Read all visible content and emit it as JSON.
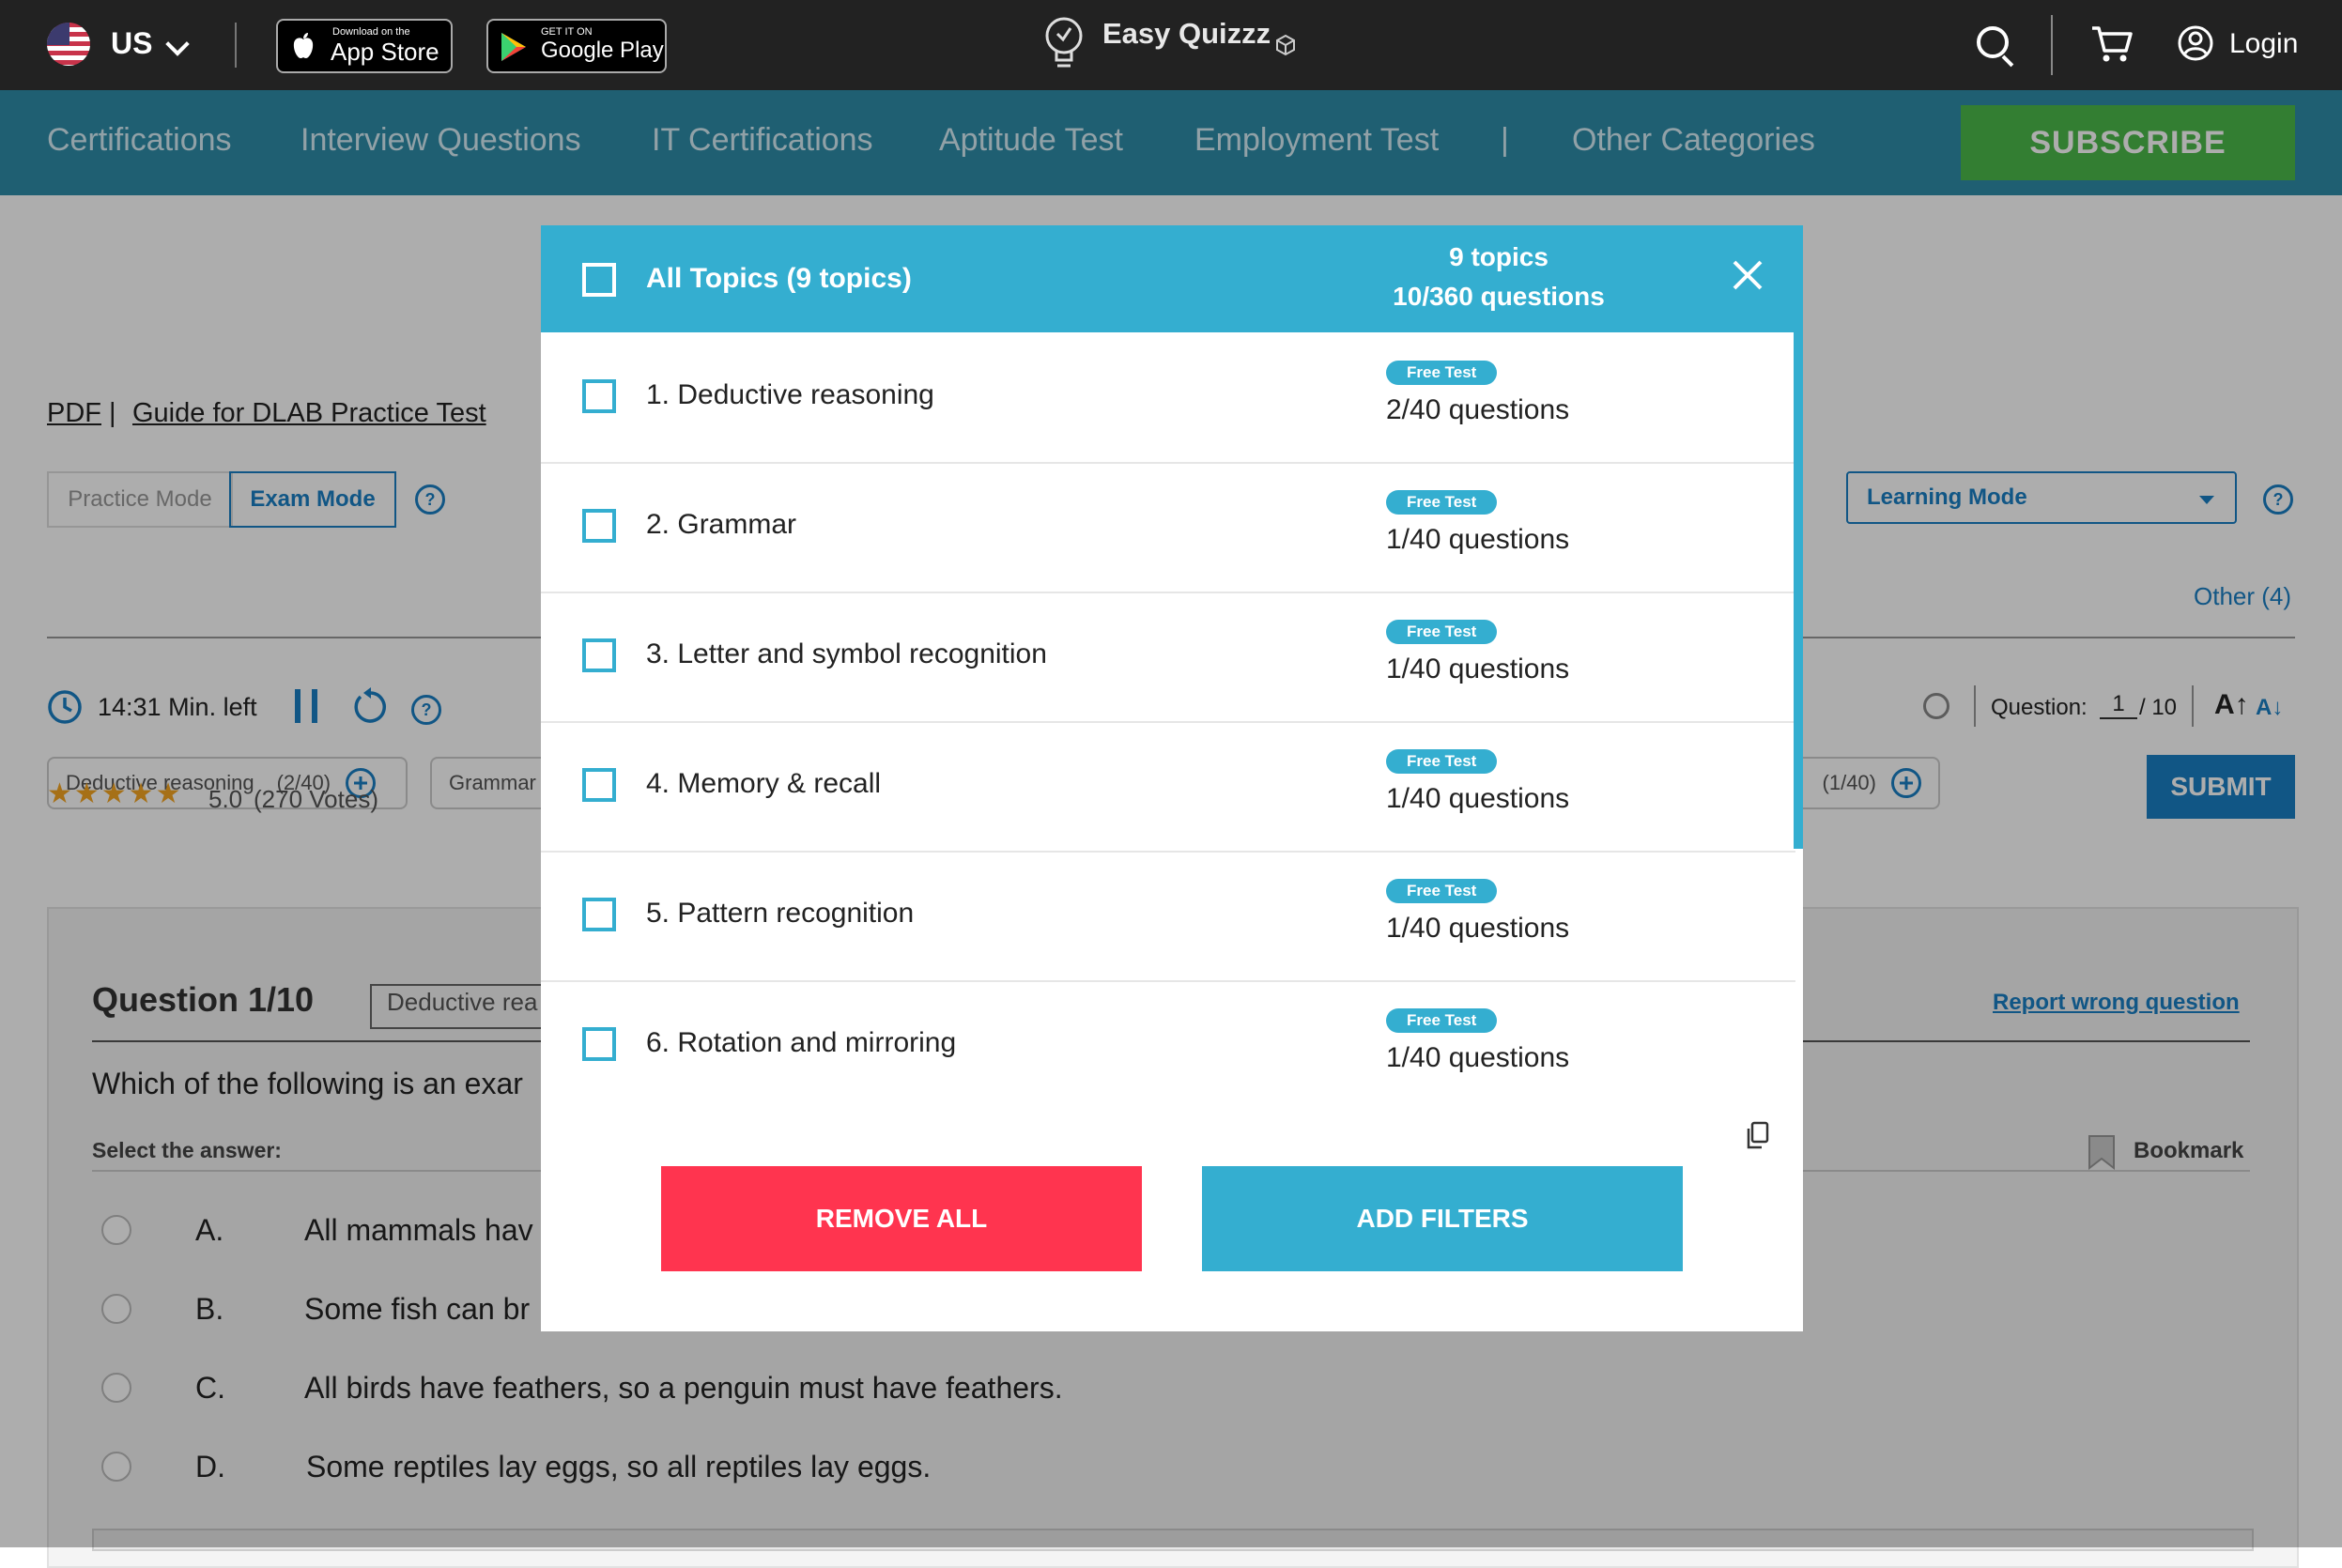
{
  "topbar": {
    "country": "US",
    "appstore_small": "Download on the",
    "appstore_big": "App Store",
    "googleplay_small": "GET IT ON",
    "googleplay_big": "Google Play",
    "brand": "Easy Quizzz",
    "login": "Login"
  },
  "nav": {
    "items": [
      "Certifications",
      "Interview Questions",
      "IT Certifications",
      "Aptitude Test",
      "Employment Test",
      "|",
      "Other Categories"
    ],
    "subscribe": "SUBSCRIBE"
  },
  "page": {
    "breadcrumb_pdf": "PDF",
    "breadcrumb_sep": "|",
    "breadcrumb_title": "Guide for DLAB Practice Test",
    "practice_mode": "Practice Mode",
    "exam_mode": "Exam Mode",
    "learning_mode": "Learning Mode",
    "chips": [
      {
        "label": "Deductive reasoning",
        "count": "(2/40)"
      },
      {
        "label": "Grammar",
        "count": ""
      },
      {
        "label": "",
        "count": "(1/40)"
      }
    ],
    "other": "Other (4)",
    "timer": "14:31 Min. left",
    "question_label": "Question:",
    "question_current": "1",
    "question_total": "/ 10",
    "rating": "5.0",
    "votes": "(270 Votes)",
    "submit": "SUBMIT",
    "question_title": "Question 1/10",
    "question_topic": "Deductive rea",
    "report": "Report wrong question",
    "question_text": "Which of the following is an exar",
    "select_answer": "Select the answer:",
    "bookmark": "Bookmark",
    "options": [
      {
        "letter": "A.",
        "text": "All mammals hav"
      },
      {
        "letter": "B.",
        "text": "Some fish can br"
      },
      {
        "letter": "C.",
        "text": "All birds have feathers, so a penguin must have feathers."
      },
      {
        "letter": "D.",
        "text": "Some reptiles lay eggs, so all reptiles lay eggs."
      }
    ]
  },
  "modal": {
    "all_topics": "All Topics (9 topics)",
    "topics_count": "9 topics",
    "questions_count": "10/360 questions",
    "topics": [
      {
        "label": "1. Deductive reasoning",
        "badge": "Free Test",
        "questions": "2/40 questions"
      },
      {
        "label": "2. Grammar",
        "badge": "Free Test",
        "questions": "1/40 questions"
      },
      {
        "label": "3. Letter and symbol recognition",
        "badge": "Free Test",
        "questions": "1/40 questions"
      },
      {
        "label": "4. Memory & recall",
        "badge": "Free Test",
        "questions": "1/40 questions"
      },
      {
        "label": "5. Pattern recognition",
        "badge": "Free Test",
        "questions": "1/40 questions"
      },
      {
        "label": "6. Rotation and mirroring",
        "badge": "Free Test",
        "questions": "1/40 questions"
      }
    ],
    "remove_all": "REMOVE ALL",
    "add_filters": "ADD FILTERS"
  }
}
